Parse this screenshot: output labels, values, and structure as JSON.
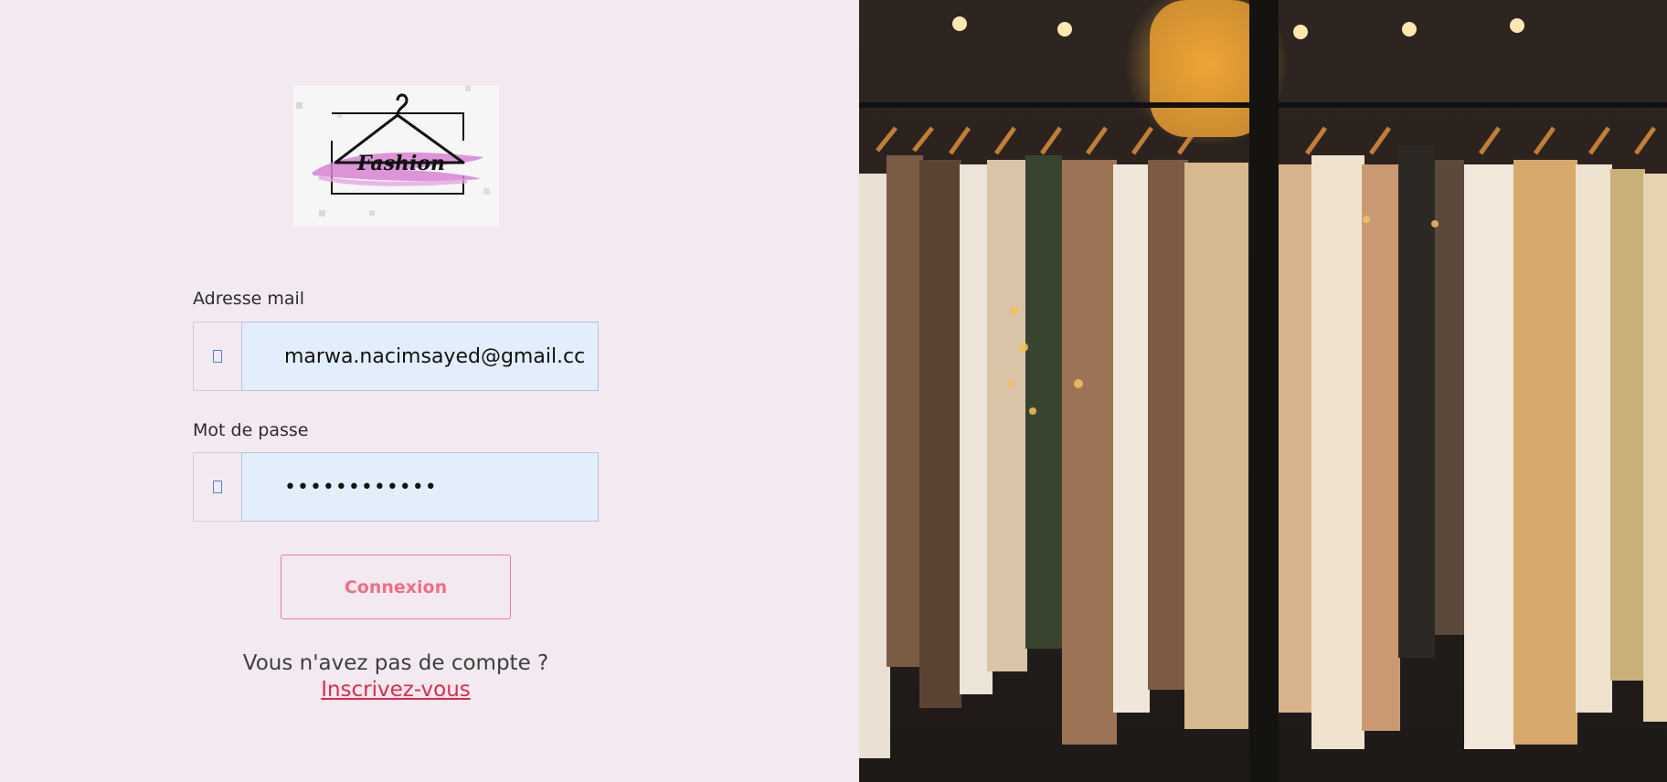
{
  "logo": {
    "text": "Fashion",
    "icon": "hanger-icon"
  },
  "form": {
    "email": {
      "label": "Adresse mail",
      "value": "marwa.nacimsayed@gmail.cc",
      "icon": "envelope-icon"
    },
    "password": {
      "label": "Mot de passe",
      "value": "••••••••••••",
      "icon": "lock-icon"
    },
    "submit_label": "Connexion"
  },
  "signup": {
    "prompt": "Vous n'avez pas de compte ? ",
    "link_label": "Inscrivez-vous"
  },
  "colors": {
    "background": "#f3eaf1",
    "accent": "#ef6f86",
    "link": "#e0294c",
    "input_bg": "#e2eefc"
  }
}
